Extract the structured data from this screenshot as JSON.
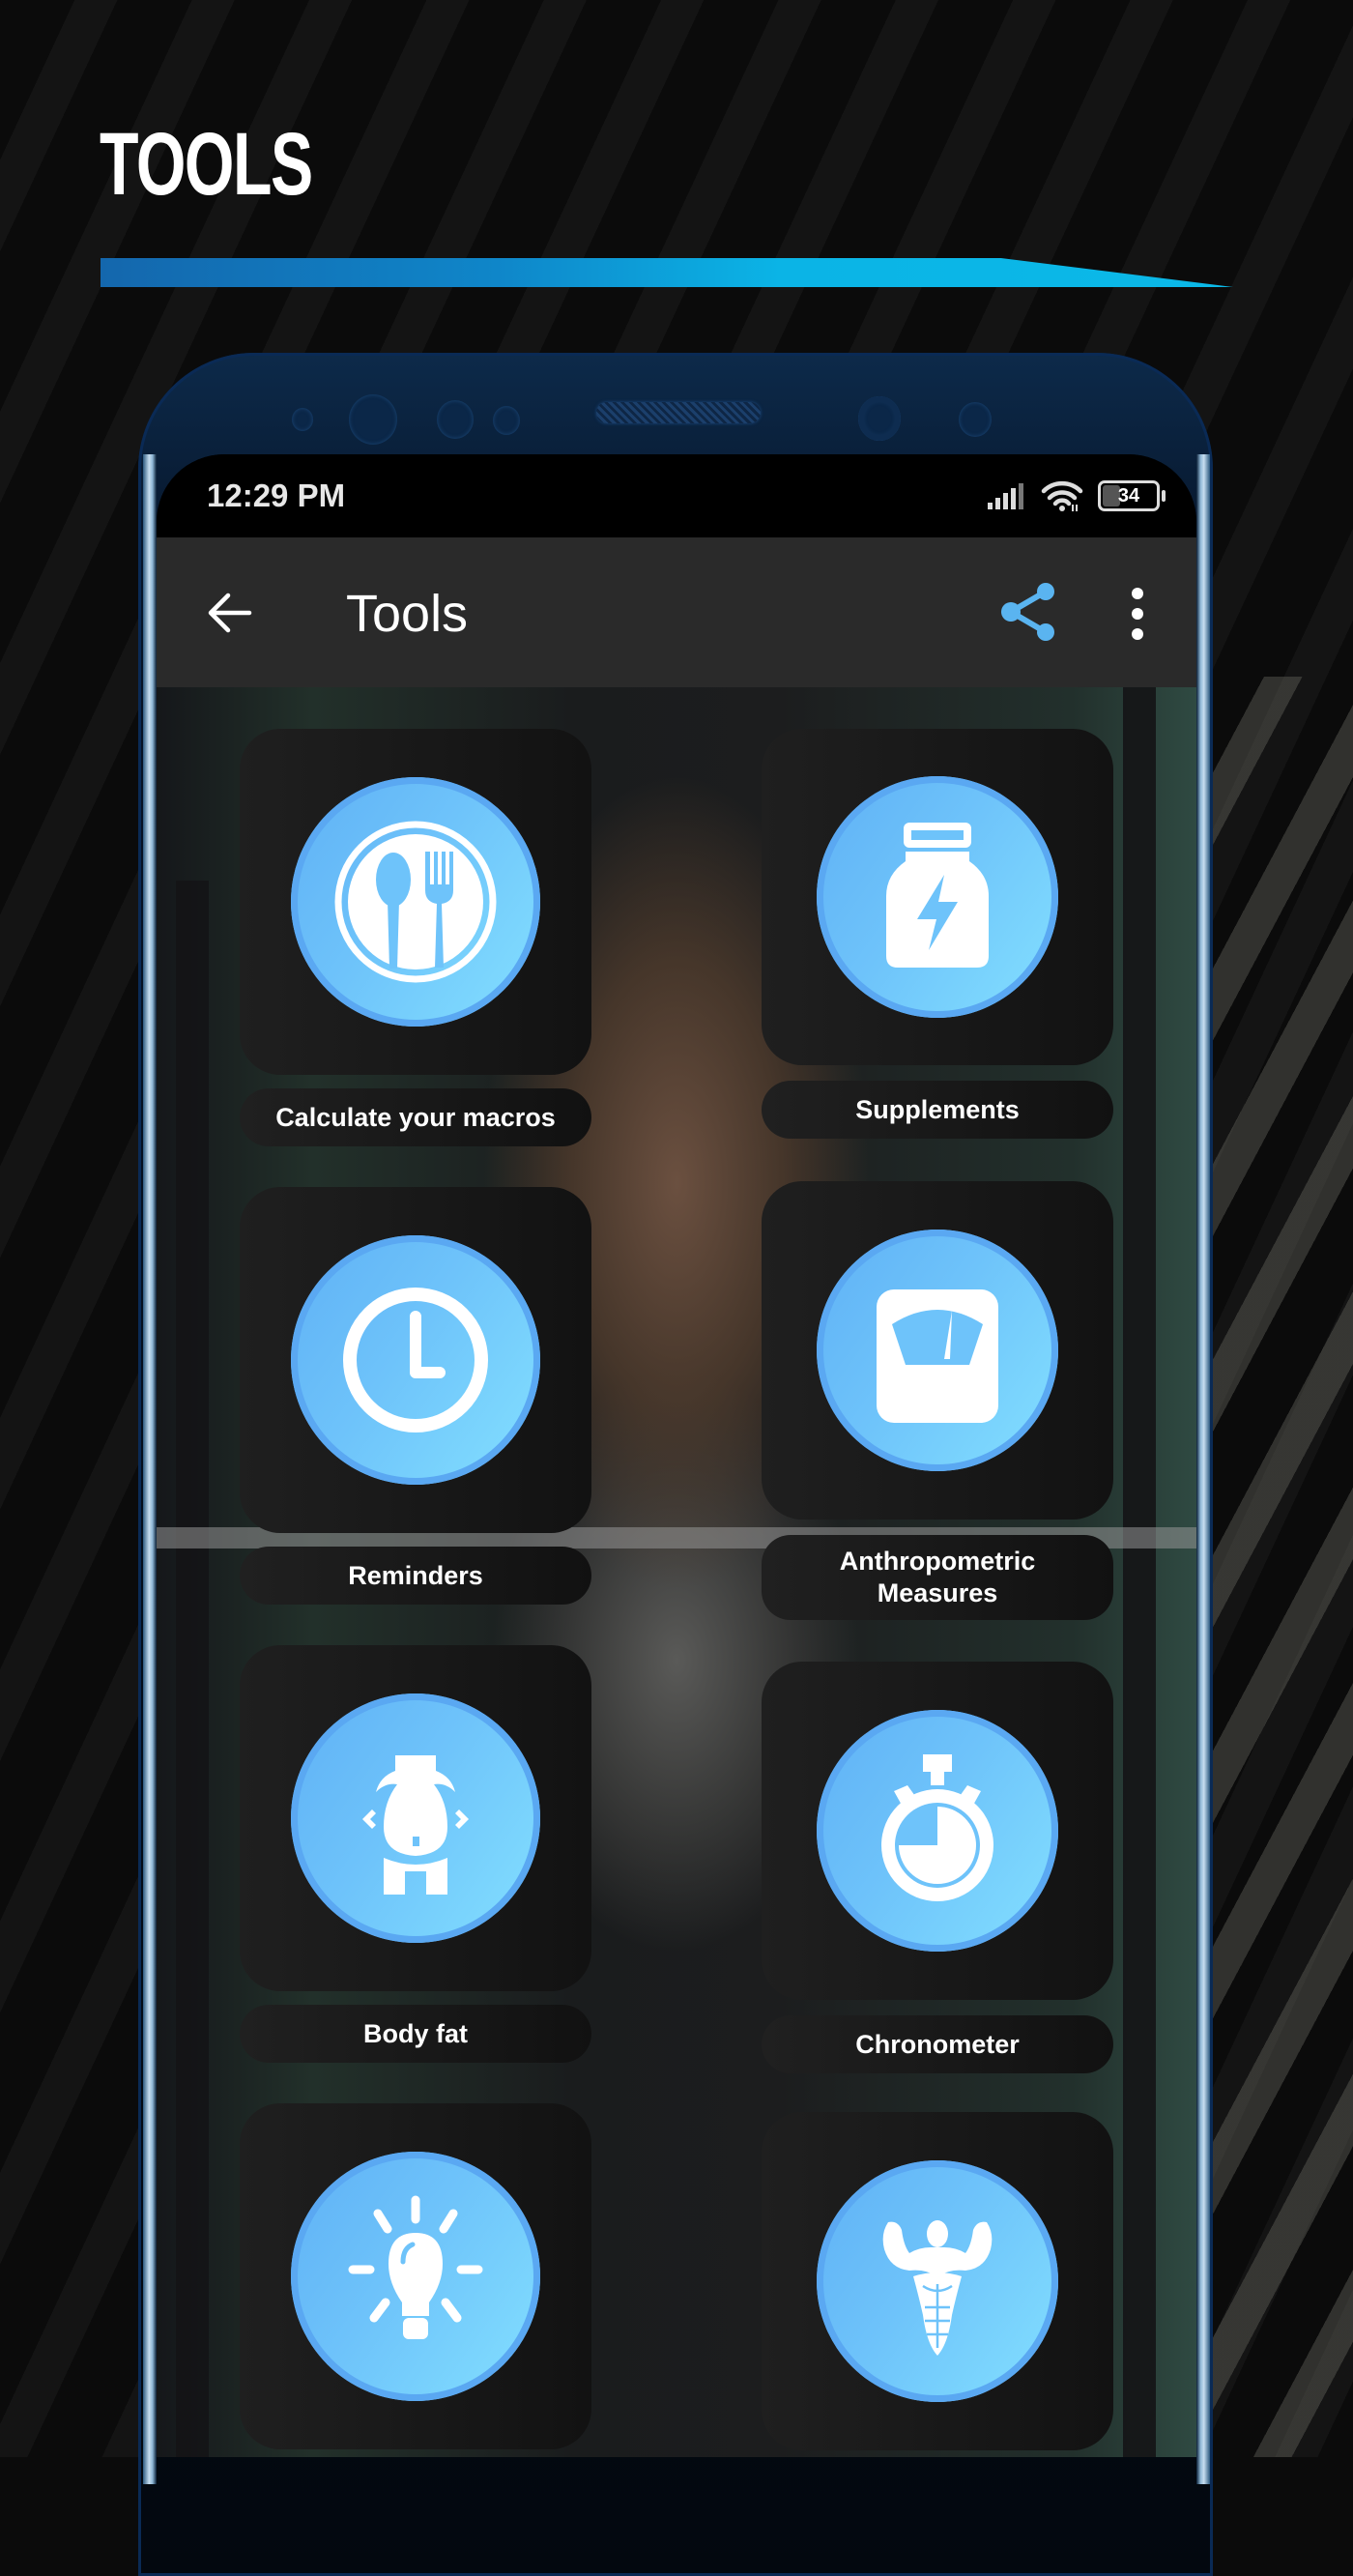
{
  "promo": {
    "title": "TOOLS",
    "accent_colors": [
      "#1467ad",
      "#0bb9e8"
    ]
  },
  "status_bar": {
    "time": "12:29 PM",
    "battery_percent": 34,
    "battery_label": "34",
    "icons": [
      "signal-icon",
      "wifi-icon",
      "battery-icon"
    ]
  },
  "app_bar": {
    "title": "Tools",
    "back_icon": "arrow-left-icon",
    "share_icon": "share-icon",
    "more_icon": "more-vertical-icon",
    "share_color": "#5ab4f0"
  },
  "tools": [
    {
      "label": "Calculate your macros",
      "icon": "plate-cutlery-icon"
    },
    {
      "label": "Supplements",
      "icon": "supplement-jar-icon"
    },
    {
      "label": "Reminders",
      "icon": "clock-icon"
    },
    {
      "label": "Anthropometric Measures",
      "icon": "scale-icon"
    },
    {
      "label": "Body fat",
      "icon": "body-fat-icon"
    },
    {
      "label": "Chronometer",
      "icon": "stopwatch-icon"
    },
    {
      "label": "",
      "icon": "lightbulb-icon"
    },
    {
      "label": "",
      "icon": "bodybuilder-icon"
    }
  ],
  "theme": {
    "icon_circle": "#6ec3fa",
    "card_bg": "#1a1a1a",
    "app_bar_bg": "#2a2a2a"
  }
}
